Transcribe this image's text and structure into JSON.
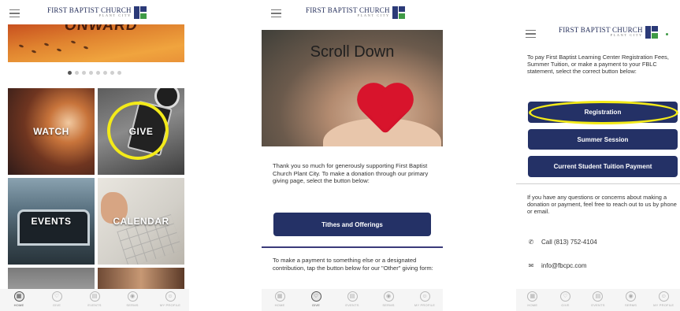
{
  "app": {
    "brand_name": "FIRST BAPTIST CHURCH",
    "brand_sub": "PLANT CITY",
    "colors": {
      "navy": "#243166",
      "brand_navy": "#2b3a78",
      "brand_green": "#3f9a46",
      "highlight": "#f3ea19"
    }
  },
  "tabbar": [
    {
      "label": "HOME",
      "icon": "home-icon",
      "glyph": "▦"
    },
    {
      "label": "GIVE",
      "icon": "heart-icon",
      "glyph": "♡"
    },
    {
      "label": "EVENTS",
      "icon": "calendar-icon",
      "glyph": "▤"
    },
    {
      "label": "SERMS",
      "icon": "play-icon",
      "glyph": "◉"
    },
    {
      "label": "MY PROFILE",
      "icon": "profile-icon",
      "glyph": "☺"
    }
  ],
  "screen1": {
    "banner_text": "ONWARD",
    "carousel": {
      "count": 8,
      "active": 1
    },
    "tiles": {
      "watch": "WATCH",
      "give": "GIVE",
      "events": "EVENTS",
      "calendar": "CALENDAR"
    },
    "active_tab": 0
  },
  "screen2": {
    "hero_title": "Scroll Down",
    "intro": "Thank you so much for generously supporting First Baptist Church Plant City. To make a donation through our primary giving page, select the button below:",
    "tithes_button": "Tithes and Offerings",
    "other_text": "To make a payment to something else or a designated contribution, tap the button below for our \"Other\" giving form:",
    "active_tab": 1
  },
  "screen3": {
    "intro": "To pay First Baptist Learning Center Registration Fees, Summer Tuition, or make a payment to your FBLC statement, select the correct button below:",
    "buttons": {
      "registration": "Registration",
      "summer": "Summer Session",
      "tuition": "Current Student Tuition Payment"
    },
    "questions_text": "If you have any questions or concerns about making a donation or payment, feel free to reach out to us by phone or email.",
    "phone": "Call (813) 752-4104",
    "email": "info@fbcpc.com",
    "active_tab": -1
  }
}
